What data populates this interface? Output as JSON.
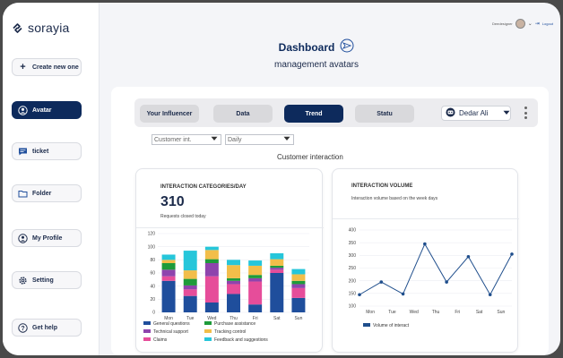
{
  "brand": {
    "name": "sorayia"
  },
  "sidebar": {
    "create_label": "Create new one",
    "items": [
      {
        "label": "Avatar",
        "icon": "user-circle-icon",
        "active": true
      },
      {
        "label": "ticket",
        "icon": "chat-icon",
        "active": false
      },
      {
        "label": "Folder",
        "icon": "folder-icon",
        "active": false
      },
      {
        "label": "My Profile",
        "icon": "profile-icon",
        "active": false
      },
      {
        "label": "Setting",
        "icon": "gear-icon",
        "active": false
      }
    ],
    "help_label": "Get help"
  },
  "header": {
    "user_name": "Deedesigner",
    "logout_label": "Logout",
    "title": "Dashboard",
    "subtitle": "management avatars"
  },
  "tabs": [
    {
      "label": "Your Influencer",
      "active": false
    },
    {
      "label": "Data",
      "active": false
    },
    {
      "label": "Trend",
      "active": true
    },
    {
      "label": "Statu",
      "active": false
    }
  ],
  "user_select": {
    "value": "Dedar Ali"
  },
  "filters": [
    {
      "value": "Customer int."
    },
    {
      "value": "Daily"
    }
  ],
  "section_title": "Customer interaction",
  "colors": {
    "accent": "#0d2a5c",
    "line": "#1f4e8c"
  },
  "panels": {
    "categories": {
      "heading": "INTERACTION CATEGORIES/DAY",
      "value": "310",
      "caption": "Requests closed today"
    },
    "volume": {
      "heading": "INTERACTION VOLUME",
      "caption": "Interaction volume based on the week days"
    }
  },
  "chart_data": [
    {
      "type": "bar",
      "stacked": true,
      "categories": [
        "Mon",
        "Tue",
        "Wed",
        "Thu",
        "Fri",
        "Sat",
        "Sun"
      ],
      "ylim": [
        0,
        120
      ],
      "yticks": [
        "0",
        "20",
        "40",
        "60",
        "80",
        "100",
        "120"
      ],
      "series": [
        {
          "name": "General questions",
          "color": "#1f4e9c",
          "values": [
            48,
            25,
            15,
            28,
            12,
            60,
            22
          ]
        },
        {
          "name": "Claims",
          "color": "#e64d9a",
          "values": [
            7,
            10,
            40,
            15,
            35,
            5,
            15
          ]
        },
        {
          "name": "Technical support",
          "color": "#8e44ad",
          "values": [
            10,
            6,
            20,
            5,
            5,
            3,
            6
          ]
        },
        {
          "name": "Purchase assistance",
          "color": "#1e9b3a",
          "values": [
            10,
            10,
            6,
            4,
            5,
            3,
            5
          ]
        },
        {
          "name": "Tracking control",
          "color": "#f2be4a",
          "values": [
            5,
            13,
            14,
            20,
            14,
            10,
            10
          ]
        },
        {
          "name": "Feedback and suggestions",
          "color": "#26c6da",
          "values": [
            8,
            30,
            5,
            8,
            8,
            9,
            8
          ]
        }
      ],
      "legend": [
        "General questions",
        "Purchase assistance",
        "Technical support",
        "Tracking control",
        "Claims",
        "Feedback and suggestions"
      ]
    },
    {
      "type": "line",
      "categories": [
        "Mon",
        "Tue",
        "Wed",
        "Thu",
        "Fri",
        "Sat",
        "Sun"
      ],
      "ylim": [
        100,
        400
      ],
      "yticks": [
        "100",
        "150",
        "200",
        "250",
        "300",
        "350",
        "400"
      ],
      "series": [
        {
          "name": "Volume of interact",
          "color": "#1f4e8c",
          "values": [
            145,
            195,
            148,
            345,
            195,
            295,
            145,
            305
          ]
        }
      ]
    }
  ]
}
